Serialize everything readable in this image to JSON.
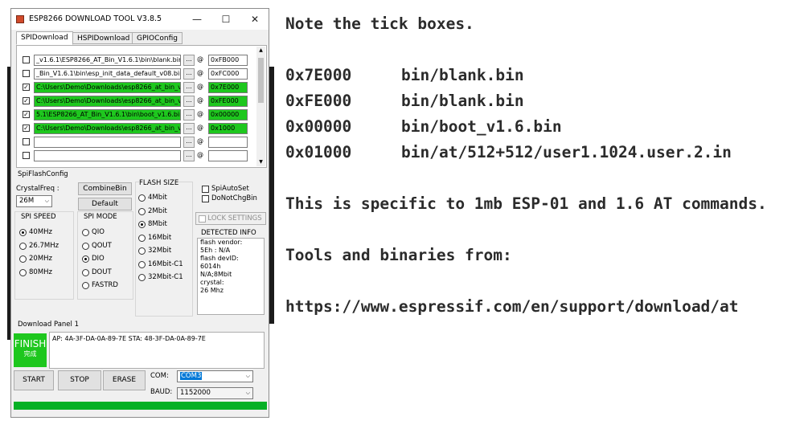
{
  "window": {
    "title": "ESP8266 DOWNLOAD TOOL V3.8.5",
    "controls": {
      "minimize": "—",
      "maximize": "☐",
      "close": "✕"
    }
  },
  "tabs": [
    "SPIDownload",
    "HSPIDownload",
    "GPIOConfig"
  ],
  "files": [
    {
      "checked": false,
      "path": "_v1.6.1\\ESP8266_AT_Bin_V1.6.1\\bin\\blank.bin",
      "addr": "0xFB000",
      "green": false
    },
    {
      "checked": false,
      "path": "_Bin_V1.6.1\\bin\\esp_init_data_default_v08.bin",
      "addr": "0xFC000",
      "green": false
    },
    {
      "checked": true,
      "path": "C:\\Users\\Demo\\Downloads\\esp8266_at_bin_v",
      "addr": "0x7E000",
      "green": true
    },
    {
      "checked": true,
      "path": "C:\\Users\\Demo\\Downloads\\esp8266_at_bin_v",
      "addr": "0xFE000",
      "green": true
    },
    {
      "checked": true,
      "path": "5.1\\ESP8266_AT_Bin_V1.6.1\\bin\\boot_v1.6.bin",
      "addr": "0x00000",
      "green": true
    },
    {
      "checked": true,
      "path": "C:\\Users\\Demo\\Downloads\\esp8266_at_bin_v",
      "addr": "0x1000",
      "green": true
    },
    {
      "checked": false,
      "path": "",
      "addr": "",
      "green": false
    },
    {
      "checked": false,
      "path": "",
      "addr": "",
      "green": false
    }
  ],
  "file_button_label": "...",
  "at_symbol": "@",
  "spi": {
    "section_label": "SpiFlashConfig",
    "crystal_label": "CrystalFreq :",
    "crystal_value": "26M",
    "combine_label": "CombineBin",
    "default_label": "Default",
    "flash_size_label": "FLASH SIZE",
    "flash_sizes": [
      "4Mbit",
      "2Mbit",
      "8Mbit",
      "16Mbit",
      "32Mbit",
      "16Mbit-C1",
      "32Mbit-C1"
    ],
    "flash_size_selected": "8Mbit",
    "spi_auto_set": "SpiAutoSet",
    "do_not_chg_bin": "DoNotChgBin",
    "lock_settings": "LOCK SETTINGS",
    "detected_label": "DETECTED INFO",
    "detected_lines": [
      "flash vendor:",
      "5Eh : N/A",
      "flash devID:",
      "6014h",
      "N/A;8Mbit",
      "crystal:",
      "26 Mhz"
    ],
    "speed_label": "SPI SPEED",
    "speeds": [
      "40MHz",
      "26.7MHz",
      "20MHz",
      "80MHz"
    ],
    "speed_selected": "40MHz",
    "mode_label": "SPI MODE",
    "modes": [
      "QIO",
      "QOUT",
      "DIO",
      "DOUT",
      "FASTRD"
    ],
    "mode_selected": "DIO"
  },
  "download": {
    "panel_label": "Download Panel 1",
    "status": "FINISH",
    "status_sub": "完成",
    "log": "AP:  4A-3F-DA-0A-89-7E  STA:  48-3F-DA-0A-89-7E",
    "start_label": "START",
    "stop_label": "STOP",
    "erase_label": "ERASE",
    "com_label": "COM:",
    "com_value": "COM3",
    "baud_label": "BAUD:",
    "baud_value": "1152000",
    "progress": 1.0
  },
  "notes": {
    "line1": "Note the tick boxes.",
    "entries": [
      {
        "addr": "0x7E000",
        "file": "bin/blank.bin"
      },
      {
        "addr": "0xFE000",
        "file": "bin/blank.bin"
      },
      {
        "addr": "0x00000",
        "file": "bin/boot_v1.6.bin"
      },
      {
        "addr": "0x01000",
        "file": "bin/at/512+512/user1.1024.user.2.in"
      }
    ],
    "specific": "This is specific to 1mb ESP-01 and 1.6 AT commands.",
    "tools": "Tools and binaries from:",
    "url": "https://www.espressif.com/en/support/download/at"
  },
  "colors": {
    "green": "#1ec71e",
    "progress": "#06b025",
    "text": "#2b2b2b"
  }
}
